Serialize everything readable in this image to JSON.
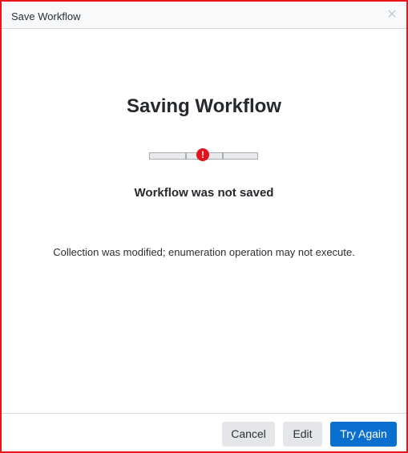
{
  "dialog": {
    "title": "Save Workflow",
    "close_icon": "close-icon",
    "heading": "Saving Workflow",
    "progress": {
      "state": "error",
      "error_icon": "exclamation-circle-icon",
      "error_glyph": "!",
      "error_color": "#e4121a"
    },
    "status": "Workflow was not saved",
    "message": "Collection was modified; enumeration operation may not execute.",
    "buttons": {
      "cancel": "Cancel",
      "edit": "Edit",
      "try_again": "Try Again"
    },
    "colors": {
      "primary": "#0b6fcf",
      "secondary": "#e4e6e9",
      "border_accent": "#e8151b"
    }
  }
}
